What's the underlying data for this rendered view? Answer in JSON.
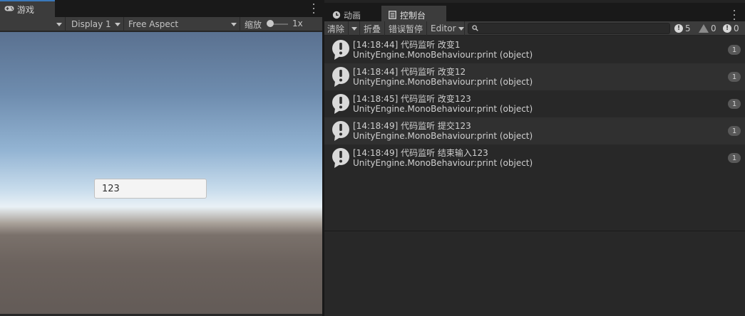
{
  "game": {
    "tab_label": "游戏",
    "toolbar": {
      "display": "Display 1",
      "aspect": "Free Aspect",
      "zoom_label": "缩放",
      "zoom_value": "1x",
      "zoom_level": 0.1
    },
    "input_value": "123"
  },
  "console": {
    "tabs": [
      {
        "label": "动画",
        "icon": "clock-icon",
        "active": false
      },
      {
        "label": "控制台",
        "icon": "console-icon",
        "active": true
      }
    ],
    "toolbar": {
      "clear": "清除",
      "collapse": "折叠",
      "error_pause": "错误暂停",
      "editor": "Editor",
      "search_placeholder": ""
    },
    "counts": {
      "info": "5",
      "warnings": "0",
      "errors": "0"
    },
    "logs": [
      {
        "line1": "[14:18:44] 代码监听 改变1",
        "line2": "UnityEngine.MonoBehaviour:print (object)",
        "count": "1"
      },
      {
        "line1": "[14:18:44] 代码监听 改变12",
        "line2": "UnityEngine.MonoBehaviour:print (object)",
        "count": "1"
      },
      {
        "line1": "[14:18:45] 代码监听 改变123",
        "line2": "UnityEngine.MonoBehaviour:print (object)",
        "count": "1"
      },
      {
        "line1": "[14:18:49] 代码监听 提交123",
        "line2": "UnityEngine.MonoBehaviour:print (object)",
        "count": "1"
      },
      {
        "line1": "[14:18:49] 代码监听 结束输入123",
        "line2": "UnityEngine.MonoBehaviour:print (object)",
        "count": "1"
      }
    ]
  },
  "colors": {
    "tab_accent": "#3a79bb",
    "panel_bg": "#282828",
    "toolbar_bg": "#3c3c3c"
  }
}
